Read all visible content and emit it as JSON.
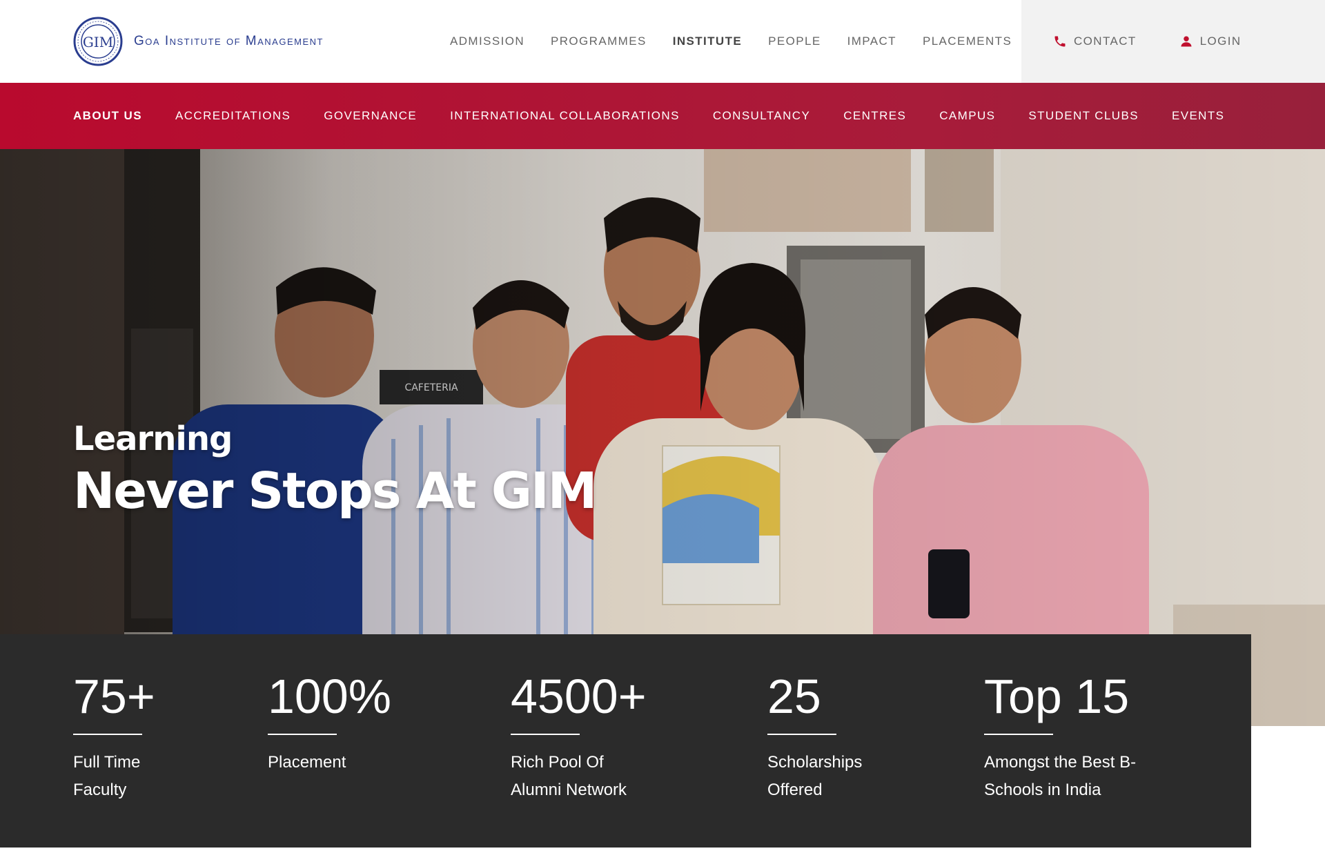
{
  "header": {
    "brand_name": "Goa Institute of Management",
    "seal_letters": "GIM",
    "nav": [
      {
        "label": "ADMISSION",
        "active": false
      },
      {
        "label": "PROGRAMMES",
        "active": false
      },
      {
        "label": "INSTITUTE",
        "active": true
      },
      {
        "label": "PEOPLE",
        "active": false
      },
      {
        "label": "IMPACT",
        "active": false
      },
      {
        "label": "PLACEMENTS",
        "active": false
      }
    ],
    "contact_label": "CONTACT",
    "login_label": "LOGIN"
  },
  "subnav": {
    "items": [
      {
        "label": "ABOUT US",
        "active": true
      },
      {
        "label": "ACCREDITATIONS",
        "active": false
      },
      {
        "label": "GOVERNANCE",
        "active": false
      },
      {
        "label": "INTERNATIONAL COLLABORATIONS",
        "active": false
      },
      {
        "label": "CONSULTANCY",
        "active": false
      },
      {
        "label": "CENTRES",
        "active": false
      },
      {
        "label": "CAMPUS",
        "active": false
      },
      {
        "label": "STUDENT CLUBS",
        "active": false
      },
      {
        "label": "EVENTS",
        "active": false
      }
    ]
  },
  "hero": {
    "line1": "Learning",
    "line2": "Never Stops At GIM"
  },
  "stats": [
    {
      "value": "75+",
      "label": "Full Time Faculty"
    },
    {
      "value": "100%",
      "label": "Placement"
    },
    {
      "value": "4500+",
      "label": "Rich Pool Of Alumni Network"
    },
    {
      "value": "25",
      "label": "Scholarships Offered"
    },
    {
      "value": "Top 15",
      "label": "Amongst the Best B-Schools in India"
    }
  ],
  "colors": {
    "brand_blue": "#2a3d8f",
    "subnav_red": "#b90a2e",
    "icon_red": "#c0102e",
    "stats_bg": "#2b2b2b"
  },
  "icons": {
    "contact": "phone-icon",
    "login": "user-icon"
  }
}
